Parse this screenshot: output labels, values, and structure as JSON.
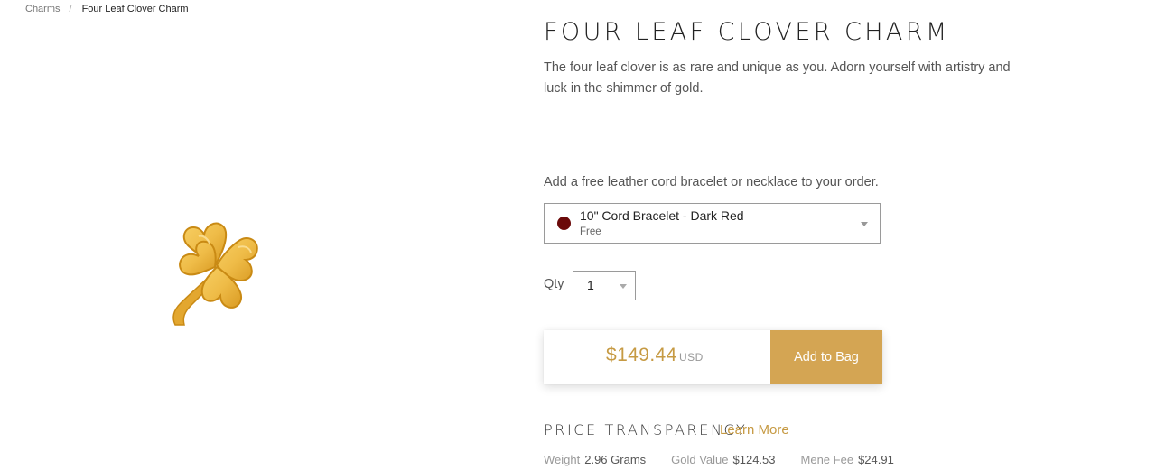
{
  "breadcrumb": {
    "parent": "Charms",
    "separator": "/",
    "current": "Four Leaf Clover Charm"
  },
  "product": {
    "title": "FOUR LEAF CLOVER CHARM",
    "description": "The four leaf clover is as rare and unique as you. Adorn yourself with artistry and luck in the shimmer of gold.",
    "image_icon": "four-leaf-clover-charm-image",
    "gold_color": "#e9b84a"
  },
  "cord": {
    "prompt": "Add a free leather cord bracelet or necklace to your order.",
    "selected_name": "10\" Cord Bracelet - Dark Red",
    "selected_price": "Free",
    "swatch_color": "#6b0a0a"
  },
  "quantity": {
    "label": "Qty",
    "value": "1"
  },
  "purchase": {
    "price": "$149.44",
    "currency": "USD",
    "add_to_bag_label": "Add to Bag",
    "accent_color": "#d4a553"
  },
  "price_transparency": {
    "heading": "PRICE TRANSPARENCY",
    "learn_more": "Learn More",
    "items": [
      {
        "label": "Weight",
        "value": "2.96 Grams"
      },
      {
        "label": "Gold Value",
        "value": "$124.53"
      },
      {
        "label": "Menē Fee",
        "value": "$24.91"
      }
    ]
  }
}
